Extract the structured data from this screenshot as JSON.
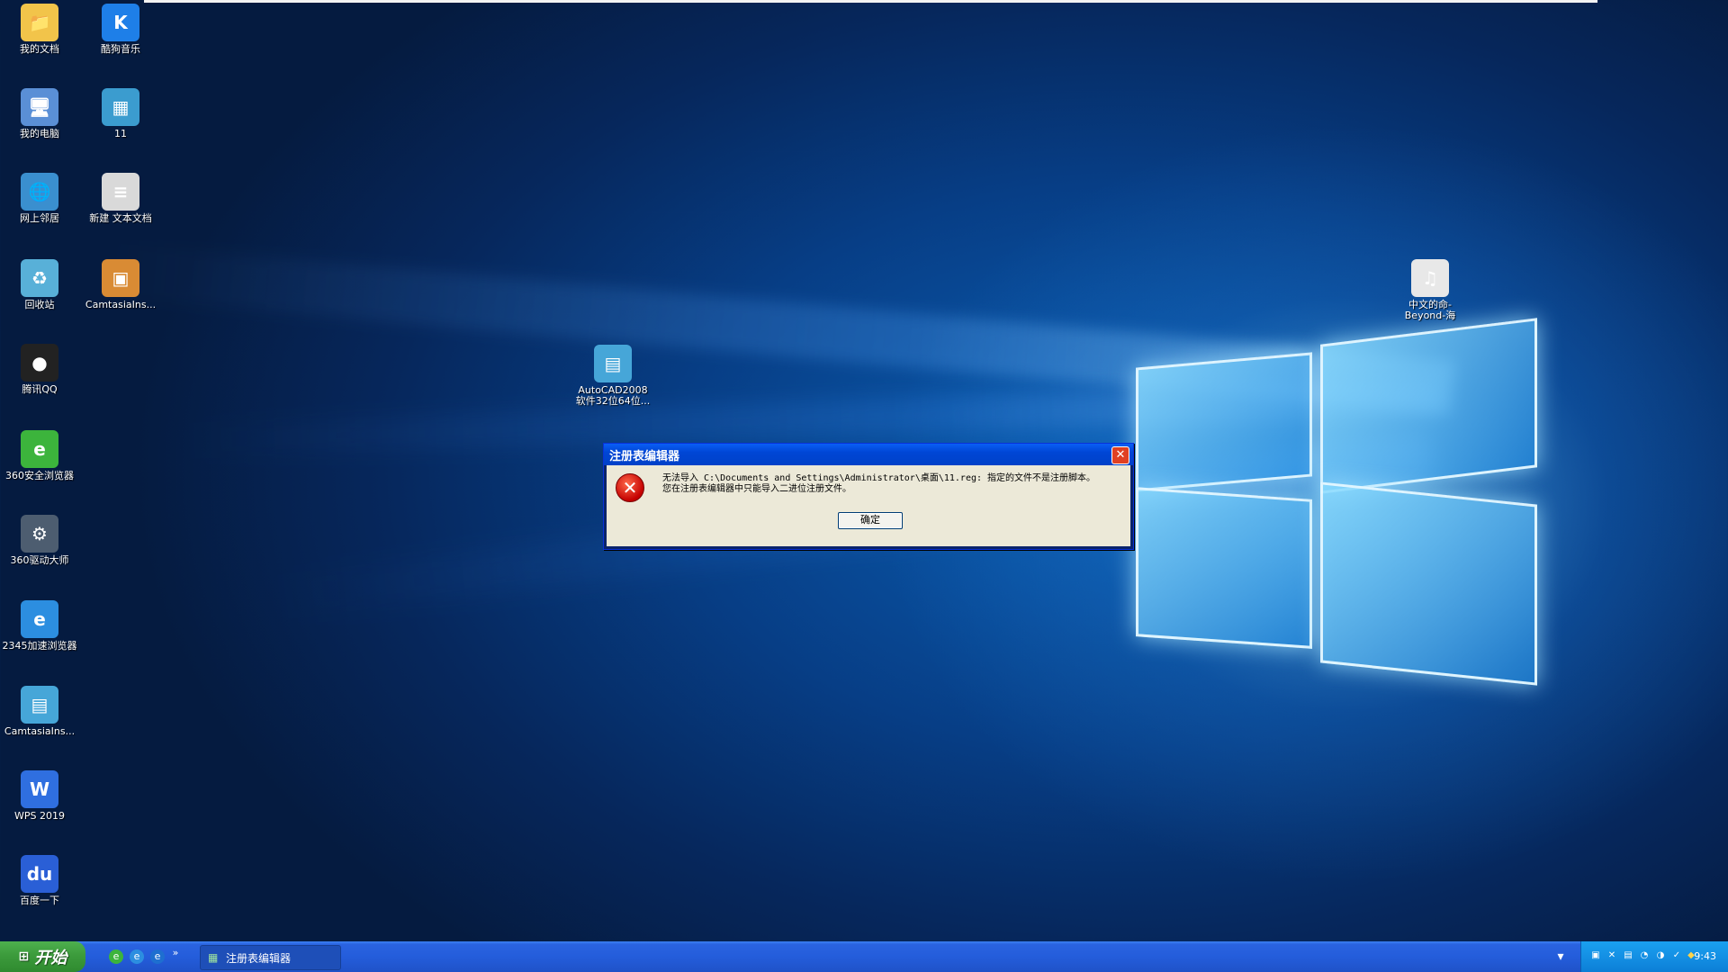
{
  "desktop": {
    "icons": [
      {
        "label": "我的文档",
        "glyph": "📁",
        "color": "#f2c44a",
        "icon": "my-documents-icon"
      },
      {
        "label": "酷狗音乐",
        "glyph": "K",
        "color": "#1e7fe8",
        "icon": "kugou-music-icon"
      },
      {
        "label": "我的电脑",
        "glyph": "🖥",
        "color": "#5a8fd6",
        "icon": "my-computer-icon"
      },
      {
        "label": "11",
        "glyph": "▦",
        "color": "#3b9ccf",
        "icon": "registry-file-icon"
      },
      {
        "label": "网上邻居",
        "glyph": "🌐",
        "color": "#3a8fcf",
        "icon": "network-places-icon"
      },
      {
        "label": "新建 文本文档",
        "glyph": "≡",
        "color": "#d9d9d9",
        "icon": "text-document-icon"
      },
      {
        "label": "回收站",
        "glyph": "♻",
        "color": "#58b0d8",
        "icon": "recycle-bin-icon"
      },
      {
        "label": "CamtasiaIns...",
        "glyph": "▣",
        "color": "#d98b34",
        "icon": "installer-package-icon"
      },
      {
        "label": "腾讯QQ",
        "glyph": "●",
        "color": "#222222",
        "icon": "qq-penguin-icon"
      },
      {
        "label": "360安全浏览器",
        "glyph": "e",
        "color": "#3cb43c",
        "icon": "360-browser-icon"
      },
      {
        "label": "360驱动大师",
        "glyph": "⚙",
        "color": "#4d5d70",
        "icon": "360-driver-icon"
      },
      {
        "label": "2345加速浏览器",
        "glyph": "e",
        "color": "#2c8ee0",
        "icon": "2345-browser-icon"
      },
      {
        "label": "CamtasiaIns...",
        "glyph": "▤",
        "color": "#46a6d8",
        "icon": "zip-archive-icon"
      },
      {
        "label": "WPS 2019",
        "glyph": "W",
        "color": "#2f6fe0",
        "icon": "wps-icon"
      },
      {
        "label": "百度一下",
        "glyph": "du",
        "color": "#2a5fd6",
        "icon": "baidu-icon"
      },
      {
        "label": "AutoCAD2008软件32位64位...",
        "glyph": "▤",
        "color": "#46a6d8",
        "icon": "zip-archive-icon"
      },
      {
        "label": "中文的命-Beyond-海",
        "glyph": "♫",
        "color": "#e8e8e8",
        "icon": "wma-audio-icon"
      }
    ]
  },
  "dialog": {
    "title": "注册表编辑器",
    "close_label": "✕",
    "message_line1": "无法导入 C:\\Documents and Settings\\Administrator\\桌面\\11.reg: 指定的文件不是注册脚本。",
    "message_line2": "您在注册表编辑器中只能导入二进位注册文件。",
    "ok_label": "确定",
    "error_glyph": "✕"
  },
  "taskbar": {
    "start_label": "开始",
    "start_flag": "⊞",
    "quicklaunch": [
      "e",
      "e",
      "e"
    ],
    "overflow": "»",
    "task_label": "注册表编辑器",
    "task_glyph": "▦",
    "tray_icons": [
      "▣",
      "✕",
      "▤",
      "◔",
      "◑",
      "✓",
      "◆"
    ],
    "notify_glyph": "▾",
    "clock": "9:43"
  }
}
